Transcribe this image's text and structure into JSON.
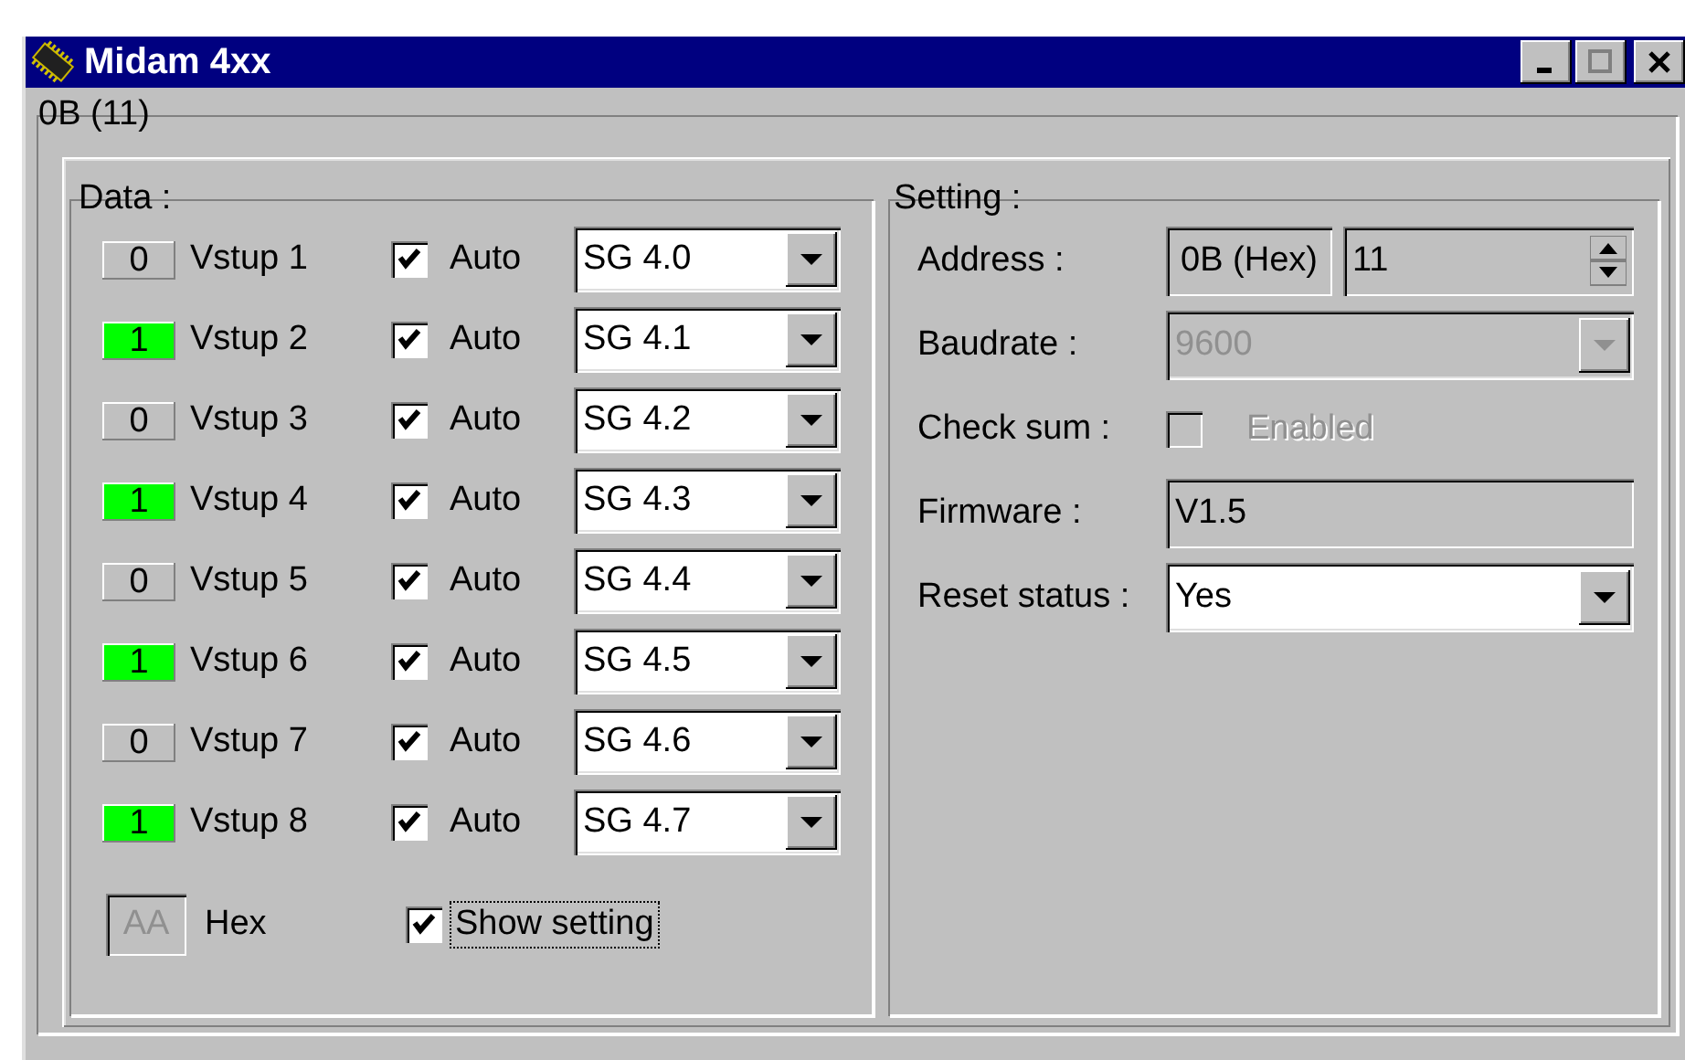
{
  "window": {
    "title": "Midam 4xx"
  },
  "device_group": {
    "label": "0B (11)"
  },
  "data_group": {
    "label": "Data :",
    "inputs": [
      {
        "value": "0",
        "on": false,
        "name": "Vstup 1",
        "auto_checked": true,
        "auto_label": "Auto",
        "signal": "SG 4.0"
      },
      {
        "value": "1",
        "on": true,
        "name": "Vstup 2",
        "auto_checked": true,
        "auto_label": "Auto",
        "signal": "SG 4.1"
      },
      {
        "value": "0",
        "on": false,
        "name": "Vstup 3",
        "auto_checked": true,
        "auto_label": "Auto",
        "signal": "SG 4.2"
      },
      {
        "value": "1",
        "on": true,
        "name": "Vstup 4",
        "auto_checked": true,
        "auto_label": "Auto",
        "signal": "SG 4.3"
      },
      {
        "value": "0",
        "on": false,
        "name": "Vstup 5",
        "auto_checked": true,
        "auto_label": "Auto",
        "signal": "SG 4.4"
      },
      {
        "value": "1",
        "on": true,
        "name": "Vstup 6",
        "auto_checked": true,
        "auto_label": "Auto",
        "signal": "SG 4.5"
      },
      {
        "value": "0",
        "on": false,
        "name": "Vstup 7",
        "auto_checked": true,
        "auto_label": "Auto",
        "signal": "SG 4.6"
      },
      {
        "value": "1",
        "on": true,
        "name": "Vstup 8",
        "auto_checked": true,
        "auto_label": "Auto",
        "signal": "SG 4.7"
      }
    ],
    "hex": {
      "display": "AA",
      "label": "Hex",
      "disabled": true
    },
    "show_setting": {
      "label": "Show setting",
      "checked": true,
      "focused": true
    }
  },
  "setting_group": {
    "label": "Setting :",
    "address": {
      "label": "Address :",
      "hex": "0B (Hex)",
      "value": "11"
    },
    "baudrate": {
      "label": "Baudrate :",
      "value": "9600",
      "disabled": true
    },
    "check_sum": {
      "label": "Check sum :",
      "checkbox_label": "Enabled",
      "checked": false,
      "disabled": true
    },
    "firmware": {
      "label": "Firmware :",
      "value": "V1.5"
    },
    "reset_status": {
      "label": "Reset status :",
      "value": "Yes"
    }
  }
}
